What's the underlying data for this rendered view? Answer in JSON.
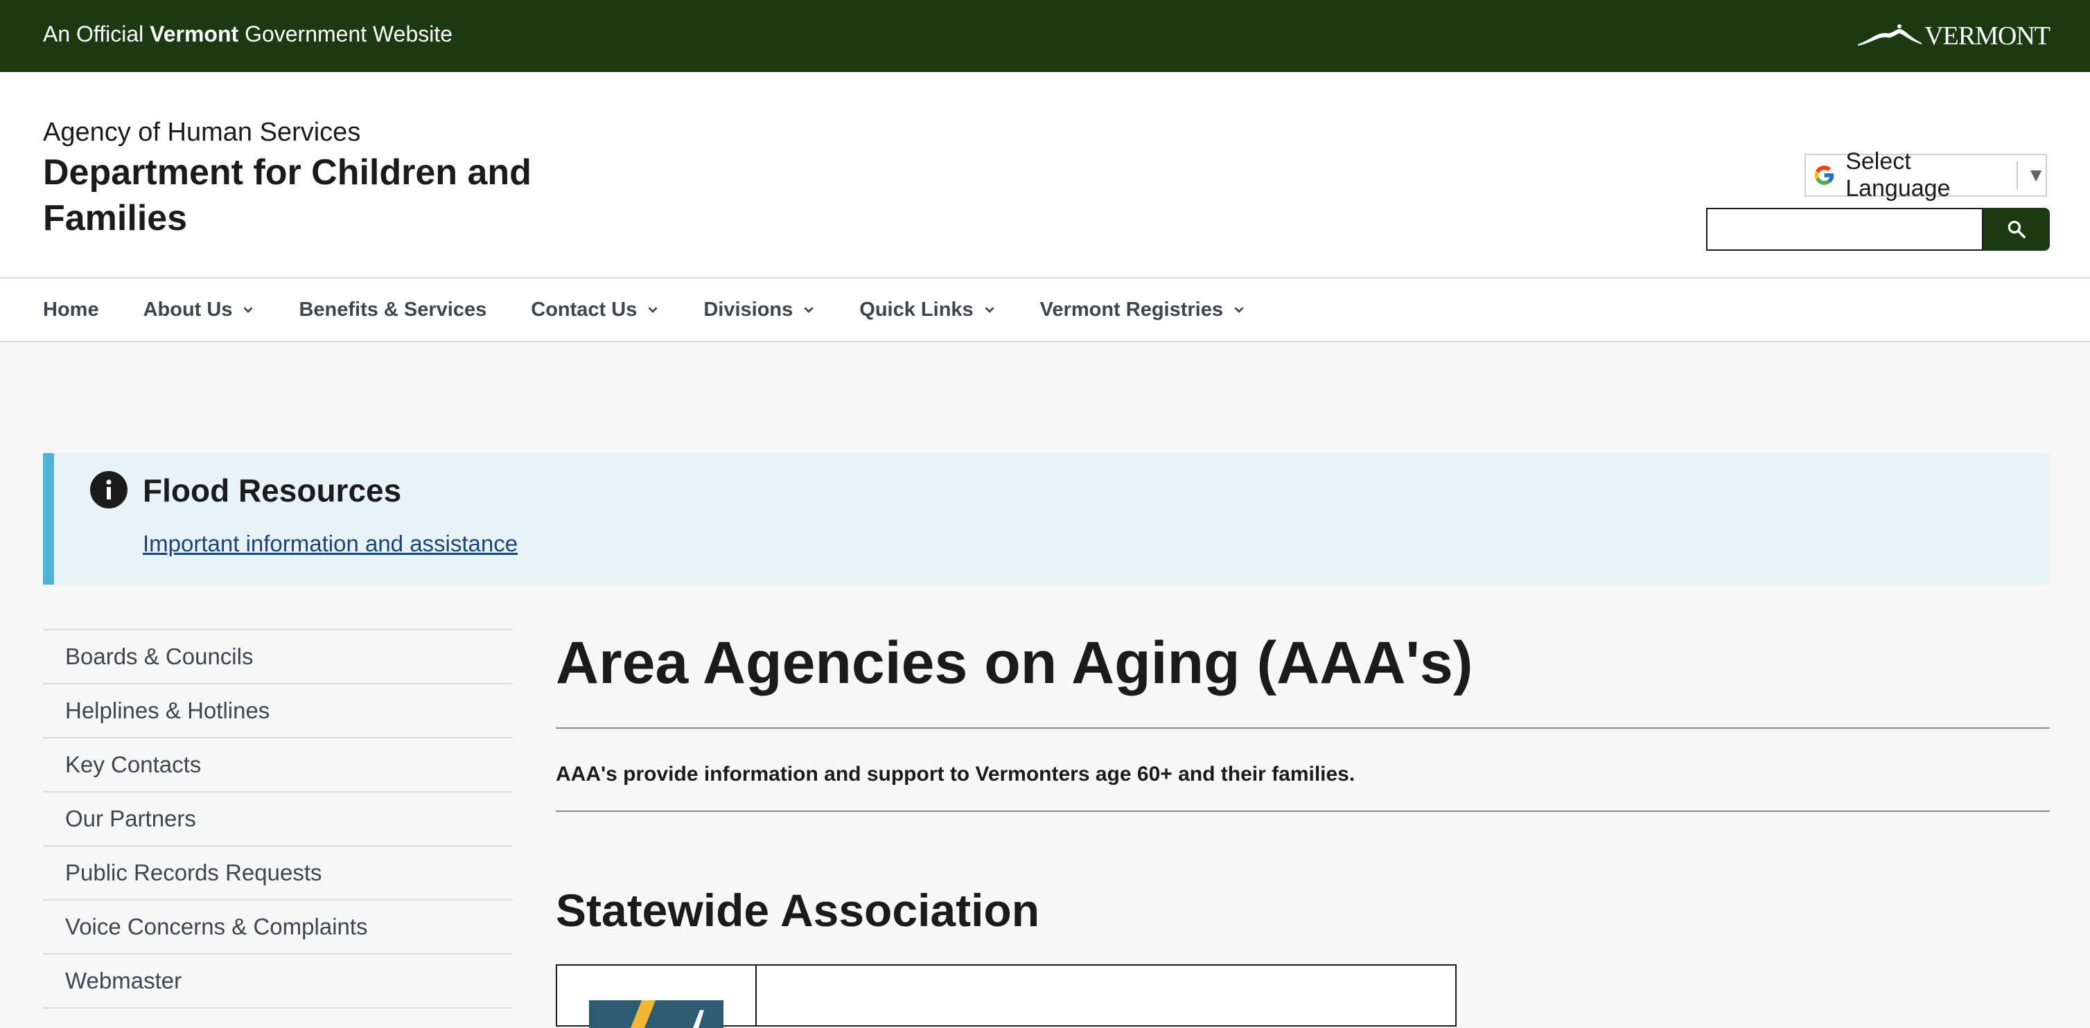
{
  "gov_bar": {
    "official_prefix": "An Official",
    "official_state": "Vermont",
    "official_suffix": "Government Website",
    "logo_text": "VERMONT"
  },
  "header": {
    "agency": "Agency of Human Services",
    "department": "Department for Children and Families",
    "language_label": "Select Language",
    "search_placeholder": ""
  },
  "nav": {
    "items": [
      {
        "label": "Home",
        "has_dropdown": false
      },
      {
        "label": "About Us",
        "has_dropdown": true
      },
      {
        "label": "Benefits & Services",
        "has_dropdown": false
      },
      {
        "label": "Contact Us",
        "has_dropdown": true
      },
      {
        "label": "Divisions",
        "has_dropdown": true
      },
      {
        "label": "Quick Links",
        "has_dropdown": true
      },
      {
        "label": "Vermont Registries",
        "has_dropdown": true
      }
    ]
  },
  "alert": {
    "title": "Flood Resources",
    "link_text": "Important information and assistance"
  },
  "sidebar": {
    "items": [
      {
        "label": "Boards & Councils"
      },
      {
        "label": "Helplines & Hotlines"
      },
      {
        "label": "Key Contacts"
      },
      {
        "label": "Our Partners"
      },
      {
        "label": "Public Records Requests"
      },
      {
        "label": "Voice Concerns & Complaints"
      },
      {
        "label": "Webmaster"
      }
    ]
  },
  "main": {
    "title": "Area Agencies on Aging (AAA's)",
    "lead": "AAA's provide information and support to Vermonters age 60+ and their families.",
    "section_title": "Statewide Association"
  },
  "colors": {
    "gov_bar": "#1b3a12",
    "alert_bg": "#e7f3f6",
    "alert_accent": "#4fb3d6",
    "link": "#1a4480"
  }
}
